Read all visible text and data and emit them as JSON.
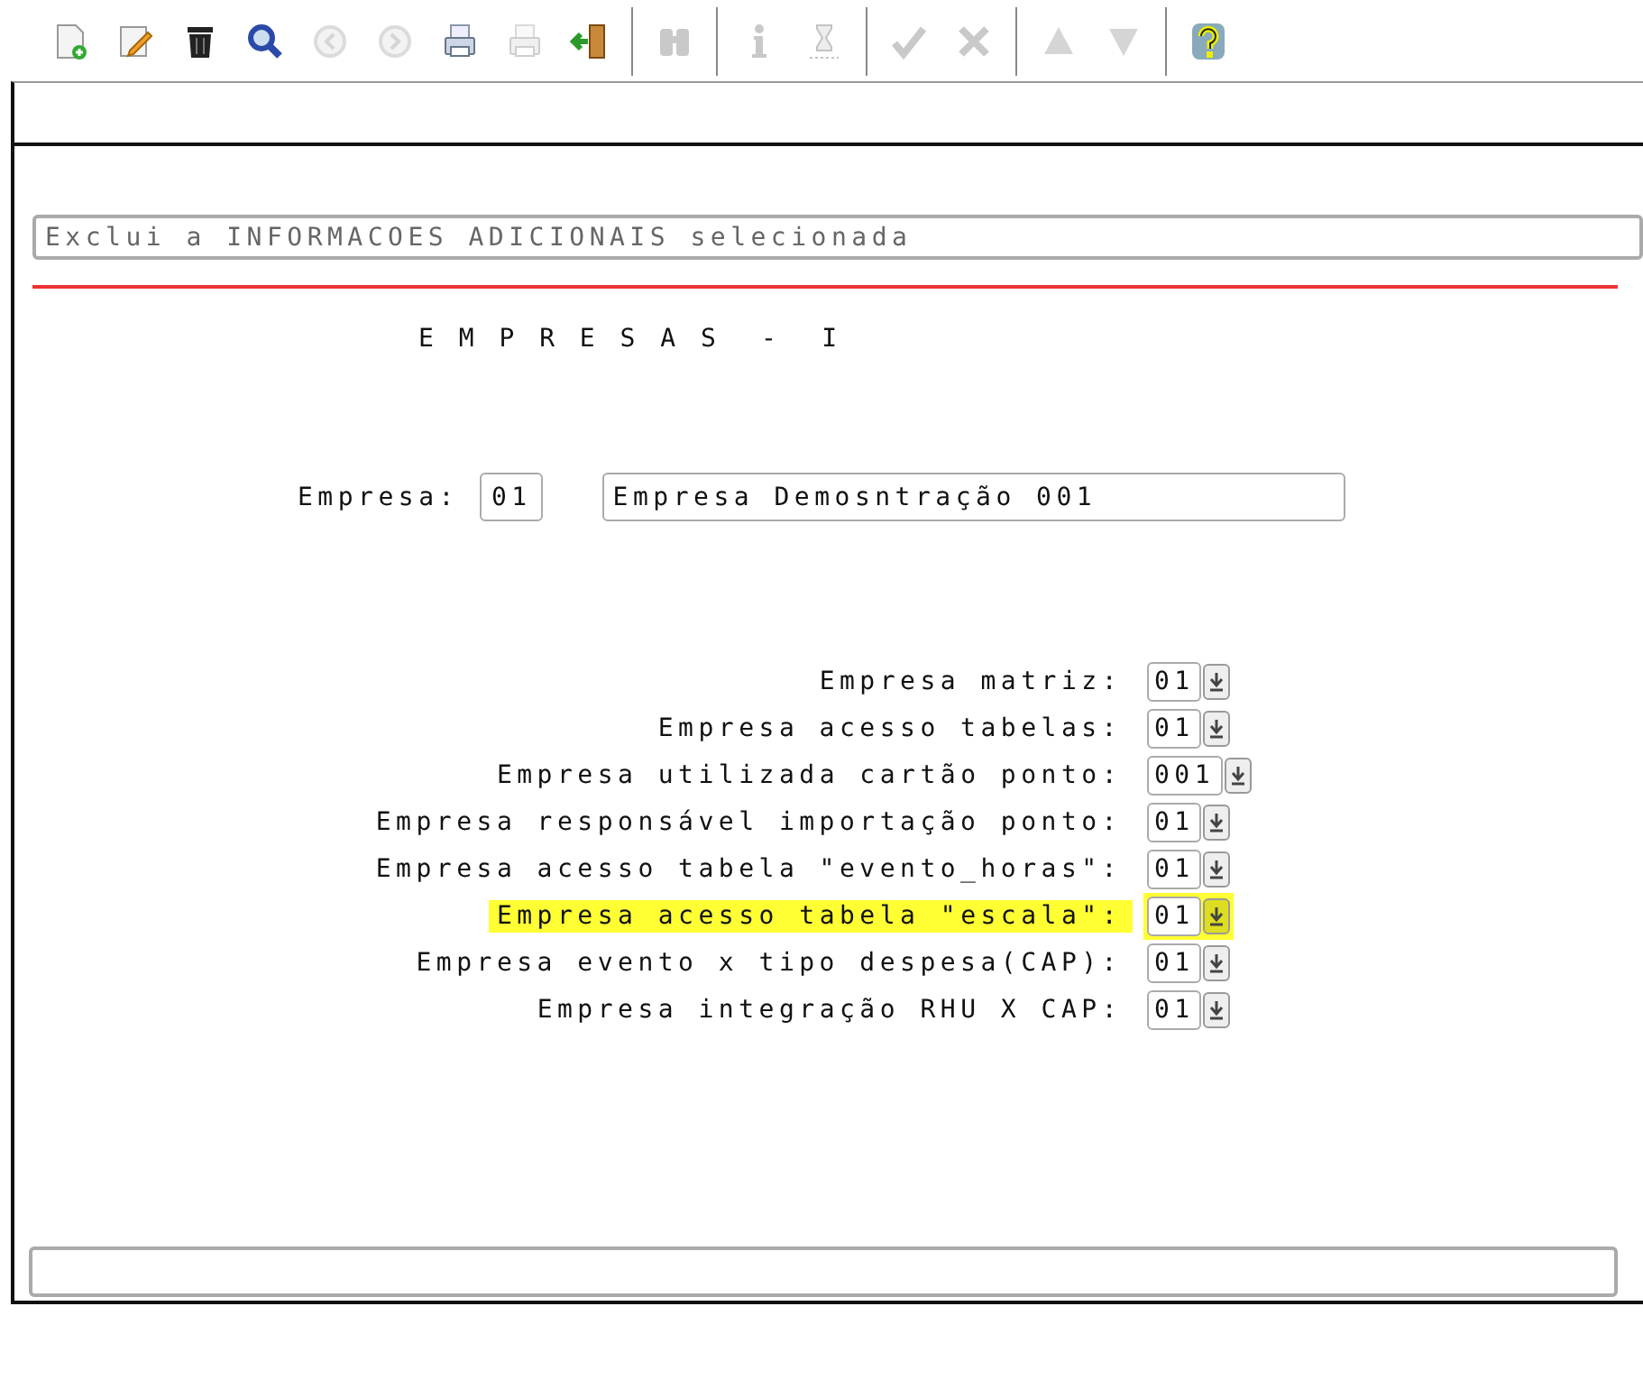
{
  "toolbar": {
    "groups": [
      {
        "items": [
          {
            "kind": "new",
            "disabled": false
          },
          {
            "kind": "edit",
            "disabled": false
          },
          {
            "kind": "delete",
            "disabled": false
          },
          {
            "kind": "search",
            "disabled": false
          },
          {
            "kind": "back",
            "disabled": true
          },
          {
            "kind": "forward",
            "disabled": true
          },
          {
            "kind": "print",
            "disabled": false
          },
          {
            "kind": "print",
            "disabled": true
          },
          {
            "kind": "exit",
            "disabled": false
          }
        ]
      },
      {
        "items": [
          {
            "kind": "binoculars",
            "disabled": true
          }
        ]
      },
      {
        "items": [
          {
            "kind": "info",
            "disabled": true
          },
          {
            "kind": "hourglass",
            "disabled": true
          }
        ]
      },
      {
        "items": [
          {
            "kind": "confirm",
            "disabled": true
          },
          {
            "kind": "cancel",
            "disabled": true
          }
        ]
      },
      {
        "items": [
          {
            "kind": "up",
            "disabled": true
          },
          {
            "kind": "down",
            "disabled": true
          }
        ]
      },
      {
        "items": [
          {
            "kind": "help",
            "disabled": false
          }
        ]
      }
    ]
  },
  "message": "Exclui a INFORMACOES ADICIONAIS selecionada",
  "title": "E M P R E S A S  -  I",
  "empresa": {
    "label": "Empresa:",
    "code": "01",
    "name": "Empresa Demosntração 001"
  },
  "fields": [
    {
      "label": "Empresa matriz:",
      "value": "01",
      "highlighted": false
    },
    {
      "label": "Empresa acesso tabelas:",
      "value": "01",
      "highlighted": false
    },
    {
      "label": "Empresa utilizada cartão ponto:",
      "value": "001",
      "highlighted": false
    },
    {
      "label": "Empresa responsável importação ponto:",
      "value": "01",
      "highlighted": false
    },
    {
      "label": "Empresa acesso tabela \"evento_horas\":",
      "value": "01",
      "highlighted": false
    },
    {
      "label": "Empresa acesso tabela \"escala\":",
      "value": "01",
      "highlighted": true
    },
    {
      "label": "Empresa evento x tipo despesa(CAP):",
      "value": "01",
      "highlighted": false
    },
    {
      "label": "Empresa integração RHU X CAP:",
      "value": "01",
      "highlighted": false
    }
  ]
}
